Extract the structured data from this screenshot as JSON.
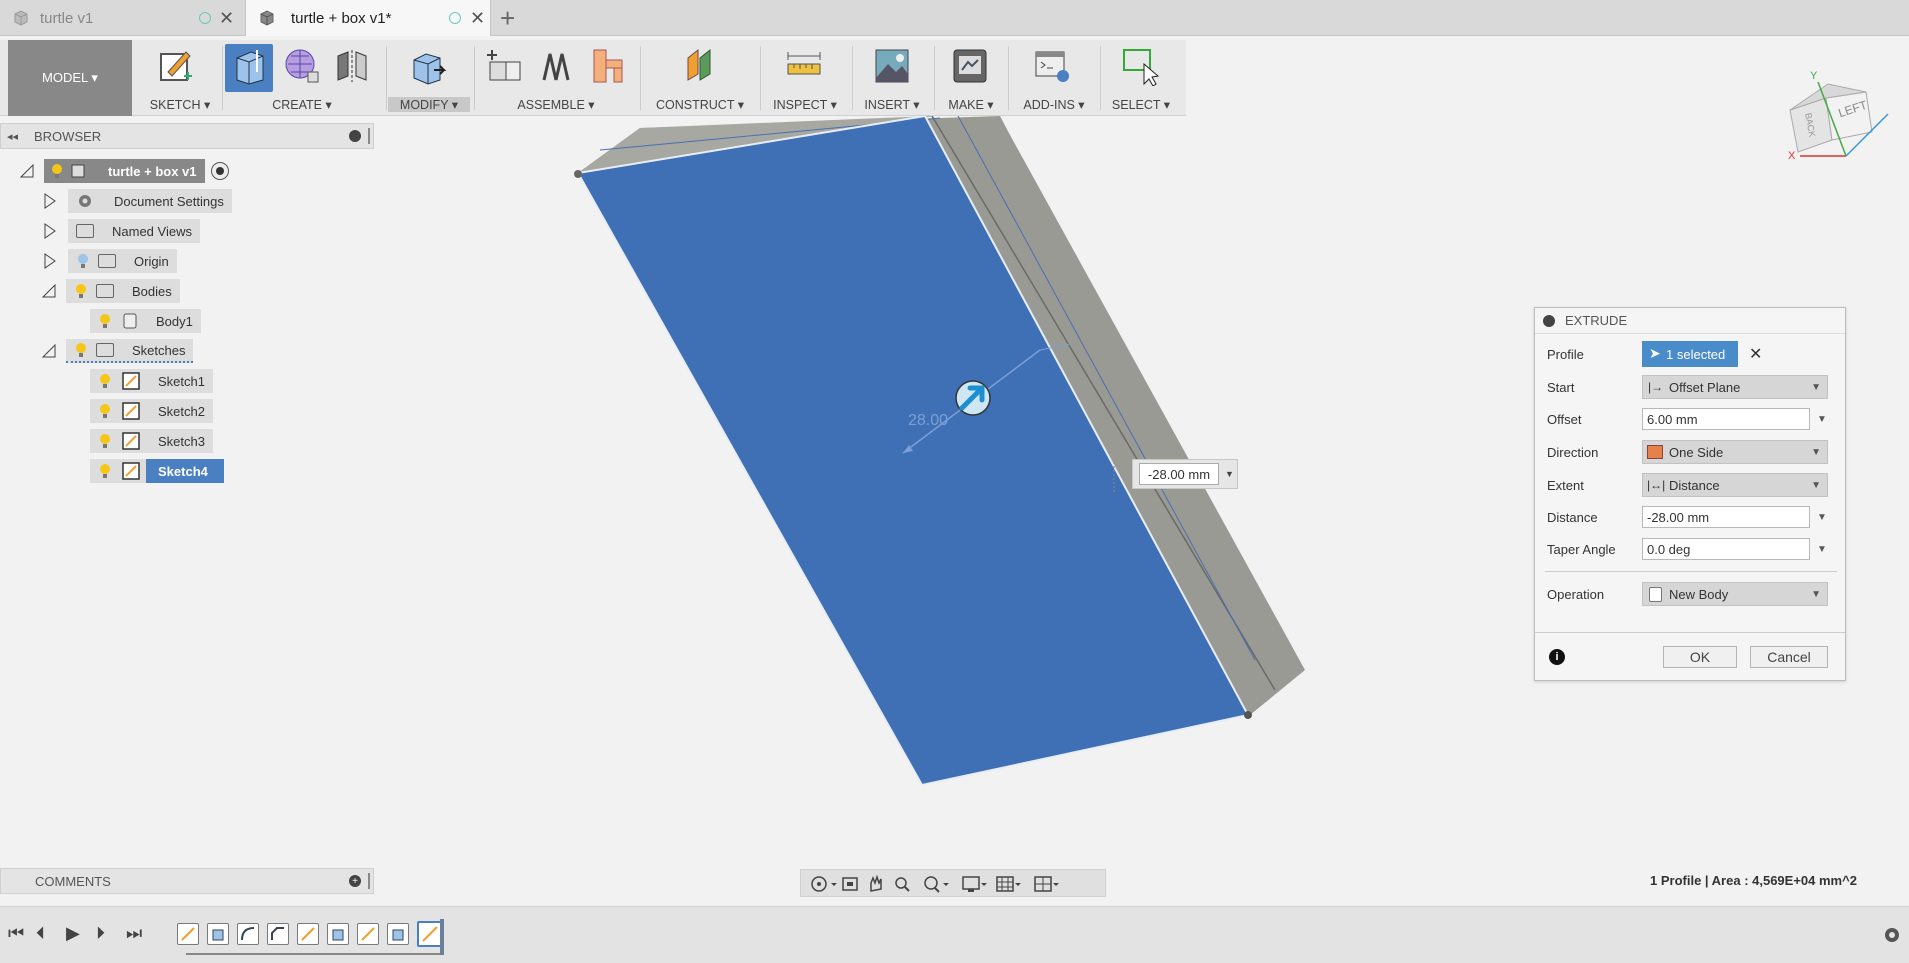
{
  "tabs": [
    {
      "title": "turtle v1",
      "active": false
    },
    {
      "title": "turtle + box v1*",
      "active": true
    }
  ],
  "new_tab": "+",
  "toolbar": {
    "workspace": "MODEL ▾",
    "groups": [
      {
        "label": "SKETCH ▾"
      },
      {
        "label": "CREATE ▾"
      },
      {
        "label": "MODIFY ▾"
      },
      {
        "label": "ASSEMBLE ▾"
      },
      {
        "label": "CONSTRUCT ▾"
      },
      {
        "label": "INSPECT ▾"
      },
      {
        "label": "INSERT ▾"
      },
      {
        "label": "MAKE ▾"
      },
      {
        "label": "ADD-INS ▾"
      },
      {
        "label": "SELECT ▾"
      }
    ]
  },
  "browser": {
    "title": "BROWSER",
    "root": "turtle + box v1",
    "items": [
      {
        "label": "Document Settings"
      },
      {
        "label": "Named Views"
      },
      {
        "label": "Origin"
      },
      {
        "label": "Bodies"
      },
      {
        "label": "Body1"
      },
      {
        "label": "Sketches"
      },
      {
        "label": "Sketch1"
      },
      {
        "label": "Sketch2"
      },
      {
        "label": "Sketch3"
      },
      {
        "label": "Sketch4"
      }
    ]
  },
  "viewcube": {
    "face": "LEFT",
    "face2": "BACK",
    "axis_x": "X",
    "axis_y": "Y"
  },
  "viewport": {
    "dim_ghost": "28.00",
    "dim_input": "-28.00 mm"
  },
  "extrude": {
    "title": "EXTRUDE",
    "rows": {
      "profile_label": "Profile",
      "profile_value": "1 selected",
      "start_label": "Start",
      "start_value": "Offset Plane",
      "offset_label": "Offset",
      "offset_value": "6.00 mm",
      "direction_label": "Direction",
      "direction_value": "One Side",
      "extent_label": "Extent",
      "extent_value": "Distance",
      "distance_label": "Distance",
      "distance_value": "-28.00 mm",
      "taper_label": "Taper Angle",
      "taper_value": "0.0 deg",
      "operation_label": "Operation",
      "operation_value": "New Body"
    },
    "ok": "OK",
    "cancel": "Cancel"
  },
  "comments": {
    "title": "COMMENTS"
  },
  "status": "1 Profile | Area : 4,569E+04 mm^2",
  "colors": {
    "face": "#3f6fb5",
    "accent": "#4a8bc9",
    "side": "#9a9a94"
  }
}
